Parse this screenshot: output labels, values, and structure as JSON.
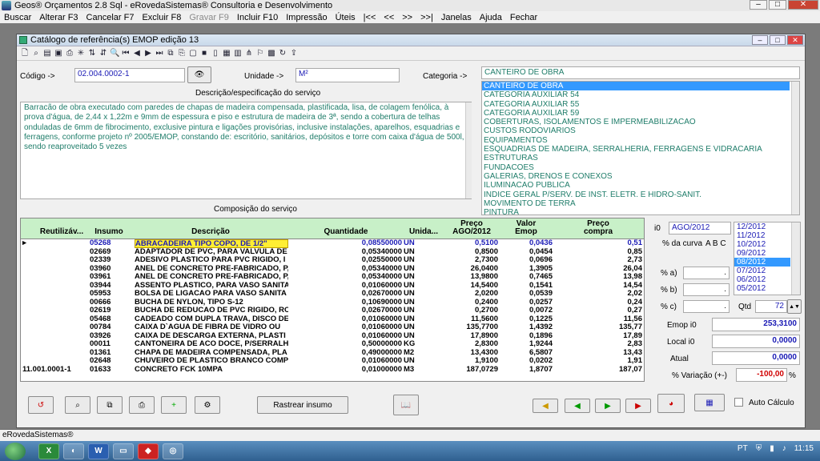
{
  "app": {
    "title": "Geos® Orçamentos 2.8 Sql - eRovedaSistemas® Consultoria e Desenvolvimento",
    "status": "eRovedaSistemas®"
  },
  "menu": [
    "Buscar",
    "Alterar F3",
    "Cancelar F7",
    "Excluir F8",
    "Gravar F9",
    "Incluir F10",
    "Impressão",
    "Úteis",
    "|<<",
    "<<",
    ">>",
    ">>|",
    "Janelas",
    "Ajuda",
    "Fechar"
  ],
  "window": {
    "title": "Catálogo de referência(s) EMOP edição 13"
  },
  "form": {
    "codigo_label": "Código ->",
    "codigo_value": "02.004.0002-1",
    "unidade_label": "Unidade ->",
    "unidade_value": "M²",
    "categoria_label": "Categoria ->",
    "categoria_value": "CANTEIRO DE OBRA",
    "descricao_label": "Descrição/especificação do serviço",
    "descricao_text": "Barracão de obra executado com paredes de chapas de madeira compensada, plastificada, lisa, de colagem fenólica, à prova d'água, de 2,44 x 1,22m e 9mm de espessura e piso e estrutura de madeira de 3ª, sendo a cobertura de telhas onduladas de 6mm de fibrocimento, exclusive pintura e ligações provisórias, inclusive instalações, aparelhos, esquadrias e ferragens, conforme projeto nº 2005/EMOP, constando de: escritório, sanitários, depósitos e torre com caixa d'água de 500l, sendo reaproveitado 5 vezes",
    "composicao_label": "Composição do serviço"
  },
  "categories": [
    "CANTEIRO DE OBRA",
    "CATEGORIA AUXILIAR 54",
    "CATEGORIA AUXILIAR 55",
    "CATEGORIA AUXILIAR 59",
    "COBERTURAS, ISOLAMENTOS E IMPERMEABILIZACAO",
    "CUSTOS RODOVIARIOS",
    "EQUIPAMENTOS",
    "ESQUADRIAS DE MADEIRA, SERRALHERIA, FERRAGENS E VIDRACARIA",
    "ESTRUTURAS",
    "FUNDACOES",
    "GALERIAS, DRENOS E CONEXOS",
    "ILUMINACAO PUBLICA",
    "INDICE GERAL P/SERV. DE INST. ELETR. E HIDRO-SANIT.",
    "MOVIMENTO DE TERRA",
    "PINTURA"
  ],
  "grid": {
    "headers": [
      "Reutilizáv...",
      "Insumo",
      "Descrição",
      "Quantidade",
      "Unida...",
      "Preço\nAGO/2012",
      "Valor\nEmop",
      "Preço\ncompra"
    ],
    "rows": [
      [
        "",
        "05268",
        "ABRACADEIRA TIPO COPO, DE 1/2\"",
        "0,08550000",
        "UN",
        "0,5100",
        "0,0436",
        "0,51"
      ],
      [
        "",
        "02669",
        "ADAPTADOR DE PVC, PARA VALVULA DE",
        "0,05340000",
        "UN",
        "0,8500",
        "0,0454",
        "0,85"
      ],
      [
        "",
        "02339",
        "ADESIVO PLASTICO PARA PVC RIGIDO, I",
        "0,02550000",
        "UN",
        "2,7300",
        "0,0696",
        "2,73"
      ],
      [
        "",
        "03960",
        "ANEL DE CONCRETO PRE-FABRICADO, P,",
        "0,05340000",
        "UN",
        "26,0400",
        "1,3905",
        "26,04"
      ],
      [
        "",
        "03961",
        "ANEL DE CONCRETO PRE-FABRICADO, P,",
        "0,05340000",
        "UN",
        "13,9800",
        "0,7465",
        "13,98"
      ],
      [
        "",
        "03944",
        "ASSENTO PLASTICO, PARA VASO SANITA",
        "0,01060000",
        "UN",
        "14,5400",
        "0,1541",
        "14,54"
      ],
      [
        "",
        "05953",
        "BOLSA DE LIGACAO PARA VASO SANITA",
        "0,02670000",
        "UN",
        "2,0200",
        "0,0539",
        "2,02"
      ],
      [
        "",
        "00666",
        "BUCHA DE NYLON, TIPO S-12",
        "0,10690000",
        "UN",
        "0,2400",
        "0,0257",
        "0,24"
      ],
      [
        "",
        "02619",
        "BUCHA DE REDUCAO DE PVC RIGIDO, RO",
        "0,02670000",
        "UN",
        "0,2700",
        "0,0072",
        "0,27"
      ],
      [
        "",
        "05468",
        "CADEADO COM DUPLA TRAVA, DISCO DE",
        "0,01060000",
        "UN",
        "11,5600",
        "0,1225",
        "11,56"
      ],
      [
        "",
        "00784",
        "CAIXA D`AGUA DE FIBRA DE VIDRO OU",
        "0,01060000",
        "UN",
        "135,7700",
        "1,4392",
        "135,77"
      ],
      [
        "",
        "03926",
        "CAIXA DE DESCARGA EXTERNA, PLASTI",
        "0,01060000",
        "UN",
        "17,8900",
        "0,1896",
        "17,89"
      ],
      [
        "",
        "00011",
        "CANTONEIRA DE ACO DOCE, P/SERRALH",
        "0,50000000",
        "KG",
        "2,8300",
        "1,9244",
        "2,83"
      ],
      [
        "",
        "01361",
        "CHAPA DE MADEIRA COMPENSADA, PLA",
        "0,49000000",
        "M2",
        "13,4300",
        "6,5807",
        "13,43"
      ],
      [
        "",
        "02648",
        "CHUVEIRO DE PLASTICO BRANCO COMPL",
        "0,01060000",
        "UN",
        "1,9100",
        "0,0202",
        "1,91"
      ],
      [
        "11.001.0001-1",
        "01633",
        "CONCRETO FCK 10MPA",
        "0,01000000",
        "M3",
        "187,0729",
        "1,8707",
        "187,07"
      ]
    ]
  },
  "right": {
    "i0_label": "i0",
    "i0_value": "AGO/2012",
    "curva_label": "% da curva",
    "curva_abc": "A B C",
    "a_label": "% a)",
    "b_label": "% b)",
    "c_label": "% c)",
    "dot": ".",
    "qtd_label": "Qtd",
    "qtd_value": "72",
    "months": [
      "12/2012",
      "11/2012",
      "10/2012",
      "09/2012",
      "08/2012",
      "07/2012",
      "06/2012",
      "05/2012"
    ],
    "emop_label": "Emop i0",
    "emop_value": "253,3100",
    "local_label": "Local i0",
    "local_value": "0,0000",
    "atual_label": "Atual",
    "atual_value": "0,0000",
    "variacao_label": "% Variação (+-)",
    "variacao_value": "-100,00",
    "pct": "%",
    "auto_label": "Auto Cálculo"
  },
  "buttons": {
    "rastrear": "Rastrear insumo"
  },
  "taskbar": {
    "lang": "PT",
    "time": "11:15"
  },
  "colors": {
    "grid_header": "#c8f0c8",
    "accent": "#1a1ab5",
    "desc_text": "#1f7d6a",
    "selection": "#3399ff",
    "negative": "#d00000"
  }
}
